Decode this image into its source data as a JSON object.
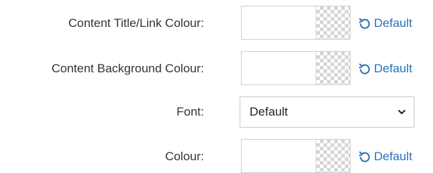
{
  "settings": {
    "rows": [
      {
        "label": "Content Title/Link Colour:",
        "control": "color",
        "reset_label": "Default"
      },
      {
        "label": "Content Background Colour:",
        "control": "color",
        "reset_label": "Default"
      },
      {
        "label": "Font:",
        "control": "select",
        "selected": "Default"
      },
      {
        "label": "Colour:",
        "control": "color",
        "reset_label": "Default"
      }
    ]
  },
  "icons": {
    "reset": "undo-arrow-icon",
    "dropdown": "chevron-down-icon"
  },
  "colors": {
    "link": "#2a72b5",
    "label_text": "#333333",
    "swatch_border": "#cfcfcf",
    "checker": "#d6d6d6"
  }
}
